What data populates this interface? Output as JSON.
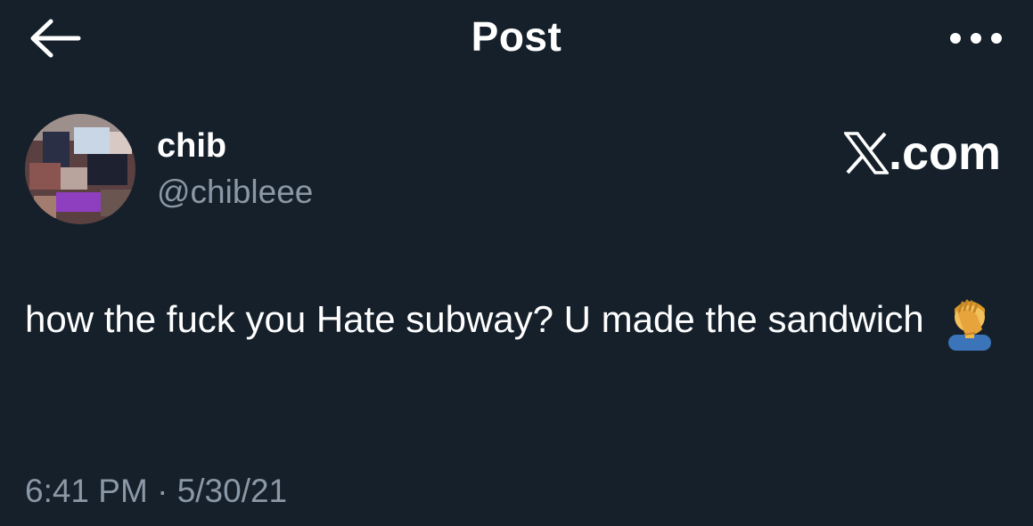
{
  "header": {
    "title": "Post",
    "back_icon": "arrow-left-icon",
    "more_icon": "more-horizontal-icon"
  },
  "author": {
    "display_name": "chib",
    "handle": "@chibleee"
  },
  "watermark": {
    "text": ".com",
    "logo_icon": "x-logo-icon"
  },
  "post": {
    "text": "how the fuck you Hate subway? U made the sandwich",
    "emoji_icon": "facepalm-emoji",
    "time": "6:41 PM",
    "separator": "·",
    "date": "5/30/21"
  },
  "colors": {
    "background": "#15202b",
    "text_primary": "#ffffff",
    "text_secondary": "#8b98a5"
  }
}
